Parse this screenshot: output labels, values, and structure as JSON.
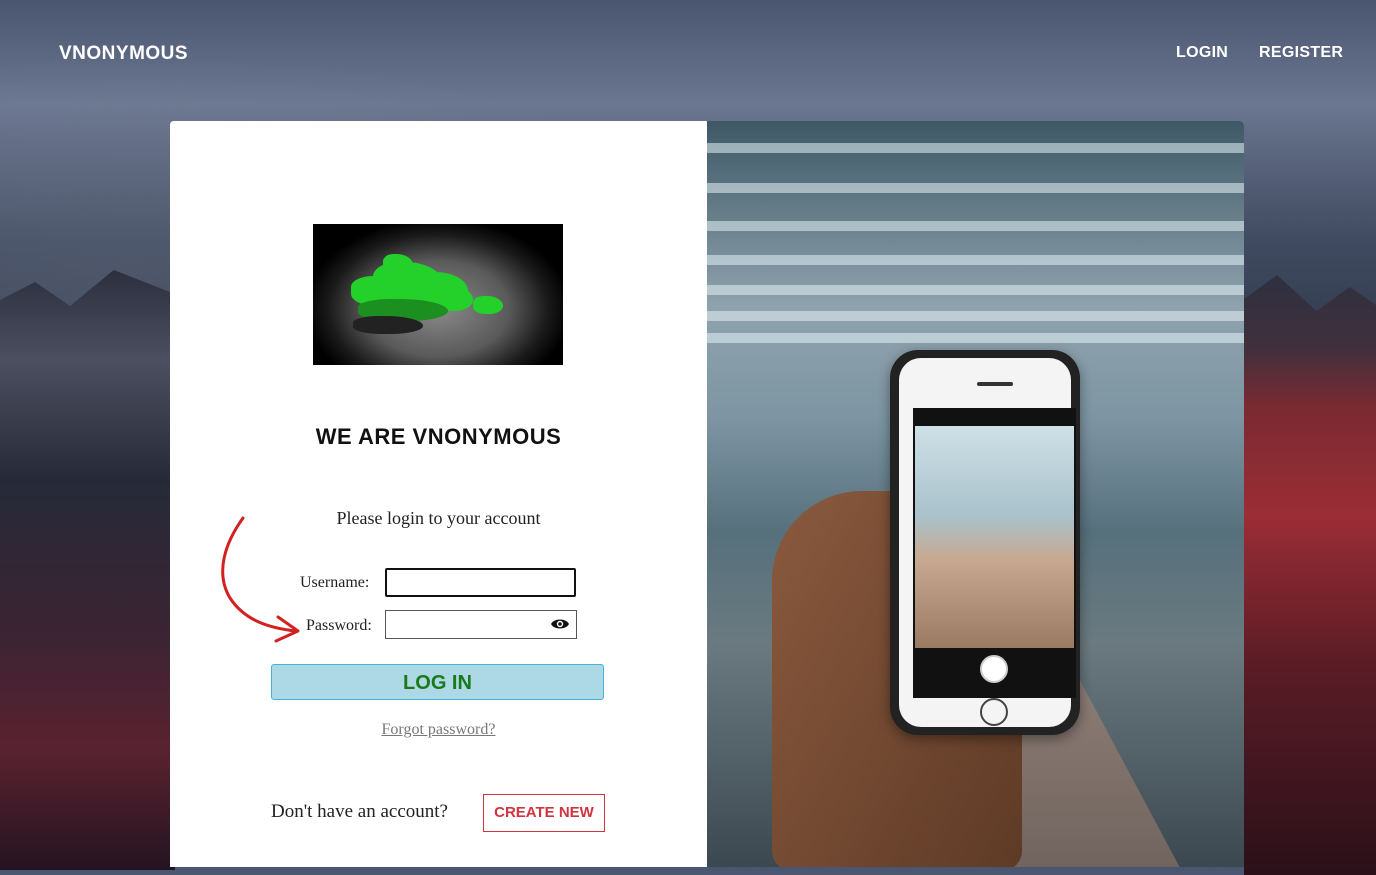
{
  "nav": {
    "brand": "VNONYMOUS",
    "login": "LOGIN",
    "register": "REGISTER"
  },
  "login_card": {
    "headline": "WE ARE VNONYMOUS",
    "subtitle": "Please login to your account",
    "username_label": "Username:",
    "username_value": "",
    "password_label": "Password:",
    "password_value": "",
    "login_button": "LOG IN",
    "forgot_link": "Forgot password?",
    "no_account_text": "Don't have an account?",
    "create_button": "CREATE NEW"
  },
  "colors": {
    "login_button_bg": "#add8e6",
    "login_button_text": "#1a7a1a",
    "create_button": "#d0343f",
    "annotation_arrow": "#d32020"
  },
  "icons": {
    "password_toggle": "eye-icon"
  }
}
